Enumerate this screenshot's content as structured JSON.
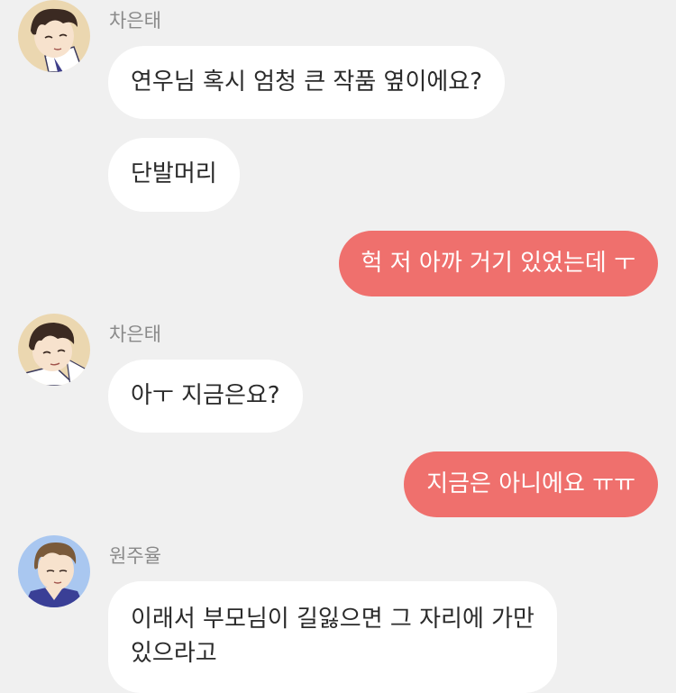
{
  "colors": {
    "background": "#f0f0f0",
    "incoming_bubble": "#ffffff",
    "outgoing_bubble": "#ef706d",
    "sender_name": "#8a8a8a"
  },
  "messages": [
    {
      "sender": "차은태",
      "avatar_icon": "avatar-chaeuntae-icon",
      "text": "연우님 혹시 엄청 큰 작품 옆이에요?"
    },
    {
      "text": "단발머리"
    },
    {
      "outgoing": true,
      "text": "헉 저 아까 거기 있었는데 ㅜ"
    },
    {
      "sender": "차은태",
      "avatar_icon": "avatar-chaeuntae-icon",
      "text": "아ㅜ 지금은요?"
    },
    {
      "outgoing": true,
      "text": "지금은 아니에요 ㅠㅠ"
    },
    {
      "sender": "원주율",
      "avatar_icon": "avatar-wonjuyul-icon",
      "lines": [
        "이래서 부모님이 길잃으면 그 자리에 가만",
        "있으라고"
      ]
    }
  ]
}
